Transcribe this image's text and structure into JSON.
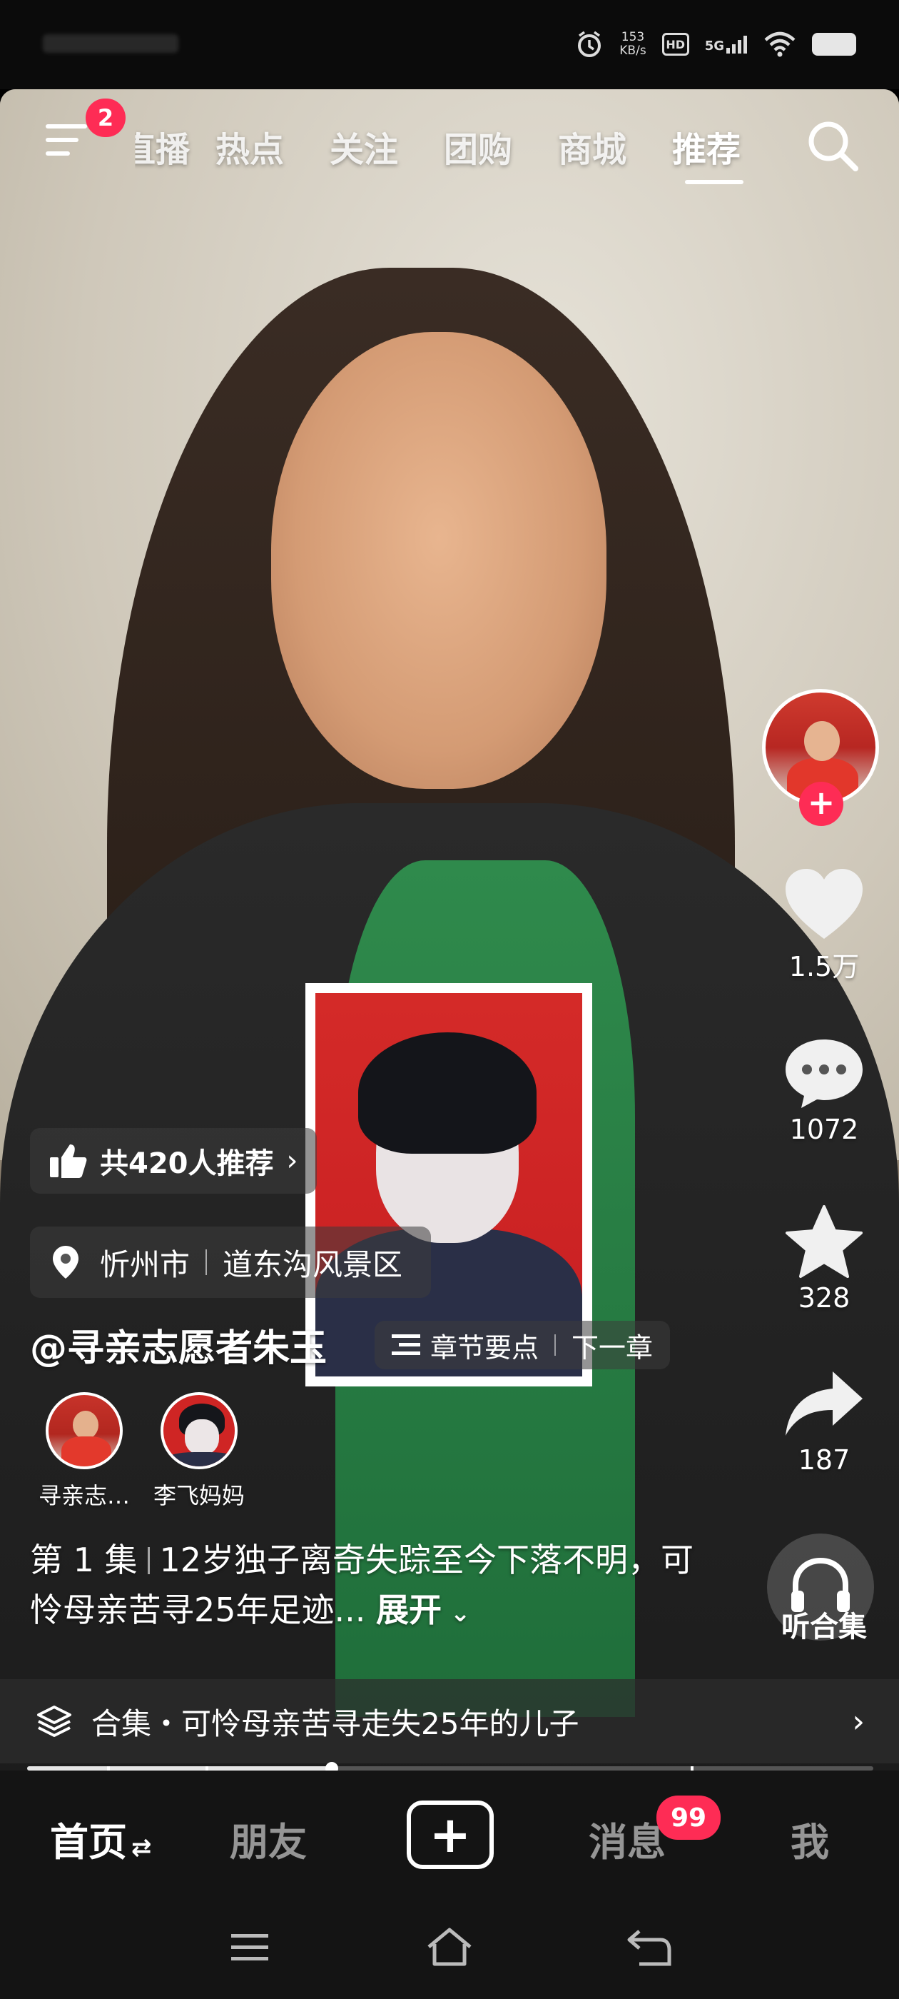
{
  "status_bar": {
    "net_speed_value": "153",
    "net_speed_unit": "KB/s",
    "hd_label": "HD",
    "network_label": "5G"
  },
  "top_nav": {
    "menu_badge": "2",
    "tabs": [
      {
        "label": "直播"
      },
      {
        "label": "热点"
      },
      {
        "label": "关注"
      },
      {
        "label": "团购"
      },
      {
        "label": "商城"
      },
      {
        "label": "推荐"
      }
    ],
    "active_tab": "推荐"
  },
  "actions": {
    "likes": "1.5万",
    "comments": "1072",
    "favorites": "328",
    "shares": "187",
    "listen_label": "听合集"
  },
  "video_info": {
    "recommend_text": "共420人推荐",
    "location_city": "忻州市",
    "location_place": "道东沟风景区",
    "author": "@寻亲志愿者朱玉",
    "chapter_points": "章节要点",
    "next_chapter": "下一章",
    "coauthors": [
      {
        "name": "寻亲志…"
      },
      {
        "name": "李飞妈妈"
      }
    ],
    "episode": "第 1 集",
    "caption": "12岁独子离奇失踪至今下落不明，可怜母亲苦寻25年足迹...",
    "expand_label": "展开",
    "collection": "合集・可怜母亲苦寻走失25年的儿子",
    "progress_fraction": 0.36
  },
  "bottom_tabs": {
    "home": "首页",
    "friends": "朋友",
    "messages": "消息",
    "messages_badge": "99",
    "me": "我"
  },
  "colors": {
    "accent": "#fe2c55",
    "tabbar_bg": "#141414"
  }
}
